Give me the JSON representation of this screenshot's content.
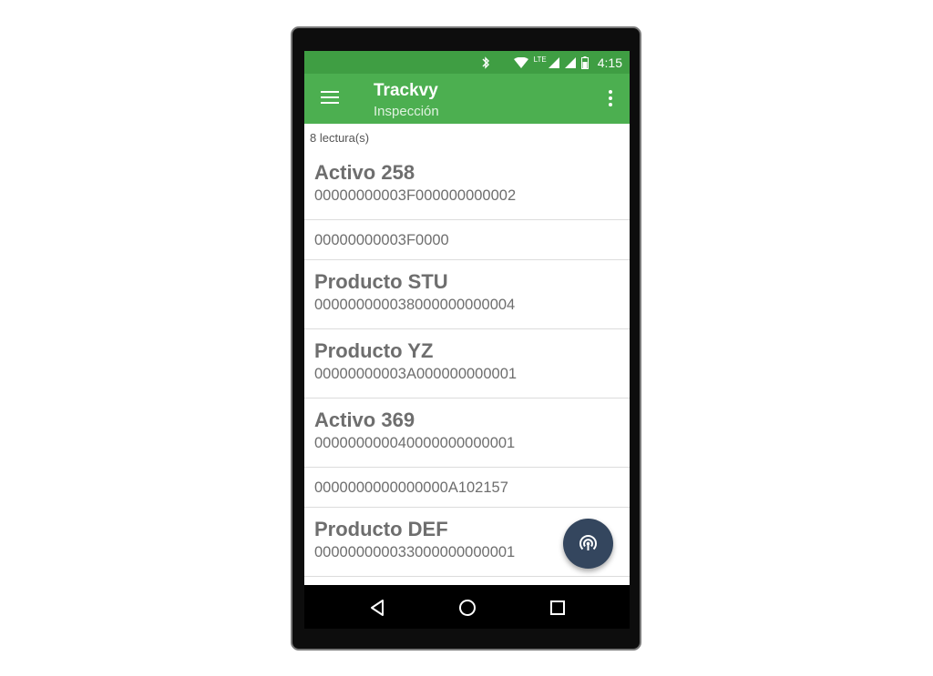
{
  "status_bar": {
    "time": "4:15",
    "network_label": "LTE",
    "icons": [
      "bluetooth-icon",
      "wifi-icon",
      "signal-icon",
      "signal-icon",
      "battery-icon"
    ]
  },
  "app_bar": {
    "title": "Trackvy",
    "subtitle": "Inspección",
    "menu_icon": "hamburger-menu-icon",
    "overflow_icon": "more-vert-icon"
  },
  "reading_count": "8 lectura(s)",
  "readings": [
    {
      "name": "Activo 258",
      "code": "00000000003F000000000002"
    },
    {
      "name": "",
      "code": "00000000003F0000"
    },
    {
      "name": "Producto STU",
      "code": "000000000038000000000004"
    },
    {
      "name": "Producto YZ",
      "code": "00000000003A000000000001"
    },
    {
      "name": "Activo 369",
      "code": "000000000040000000000001"
    },
    {
      "name": "",
      "code": "0000000000000000A102157"
    },
    {
      "name": "Producto DEF",
      "code": "000000000033000000000001"
    }
  ],
  "fab": {
    "icon": "rfid-scan-icon"
  },
  "navigation_bar": {
    "icons": [
      "back-icon",
      "home-icon",
      "recents-icon"
    ]
  },
  "colors": {
    "status_bar": "#3f9e43",
    "app_bar": "#4caf50",
    "fab": "#34465e",
    "item_text": "#6e6e6e"
  }
}
